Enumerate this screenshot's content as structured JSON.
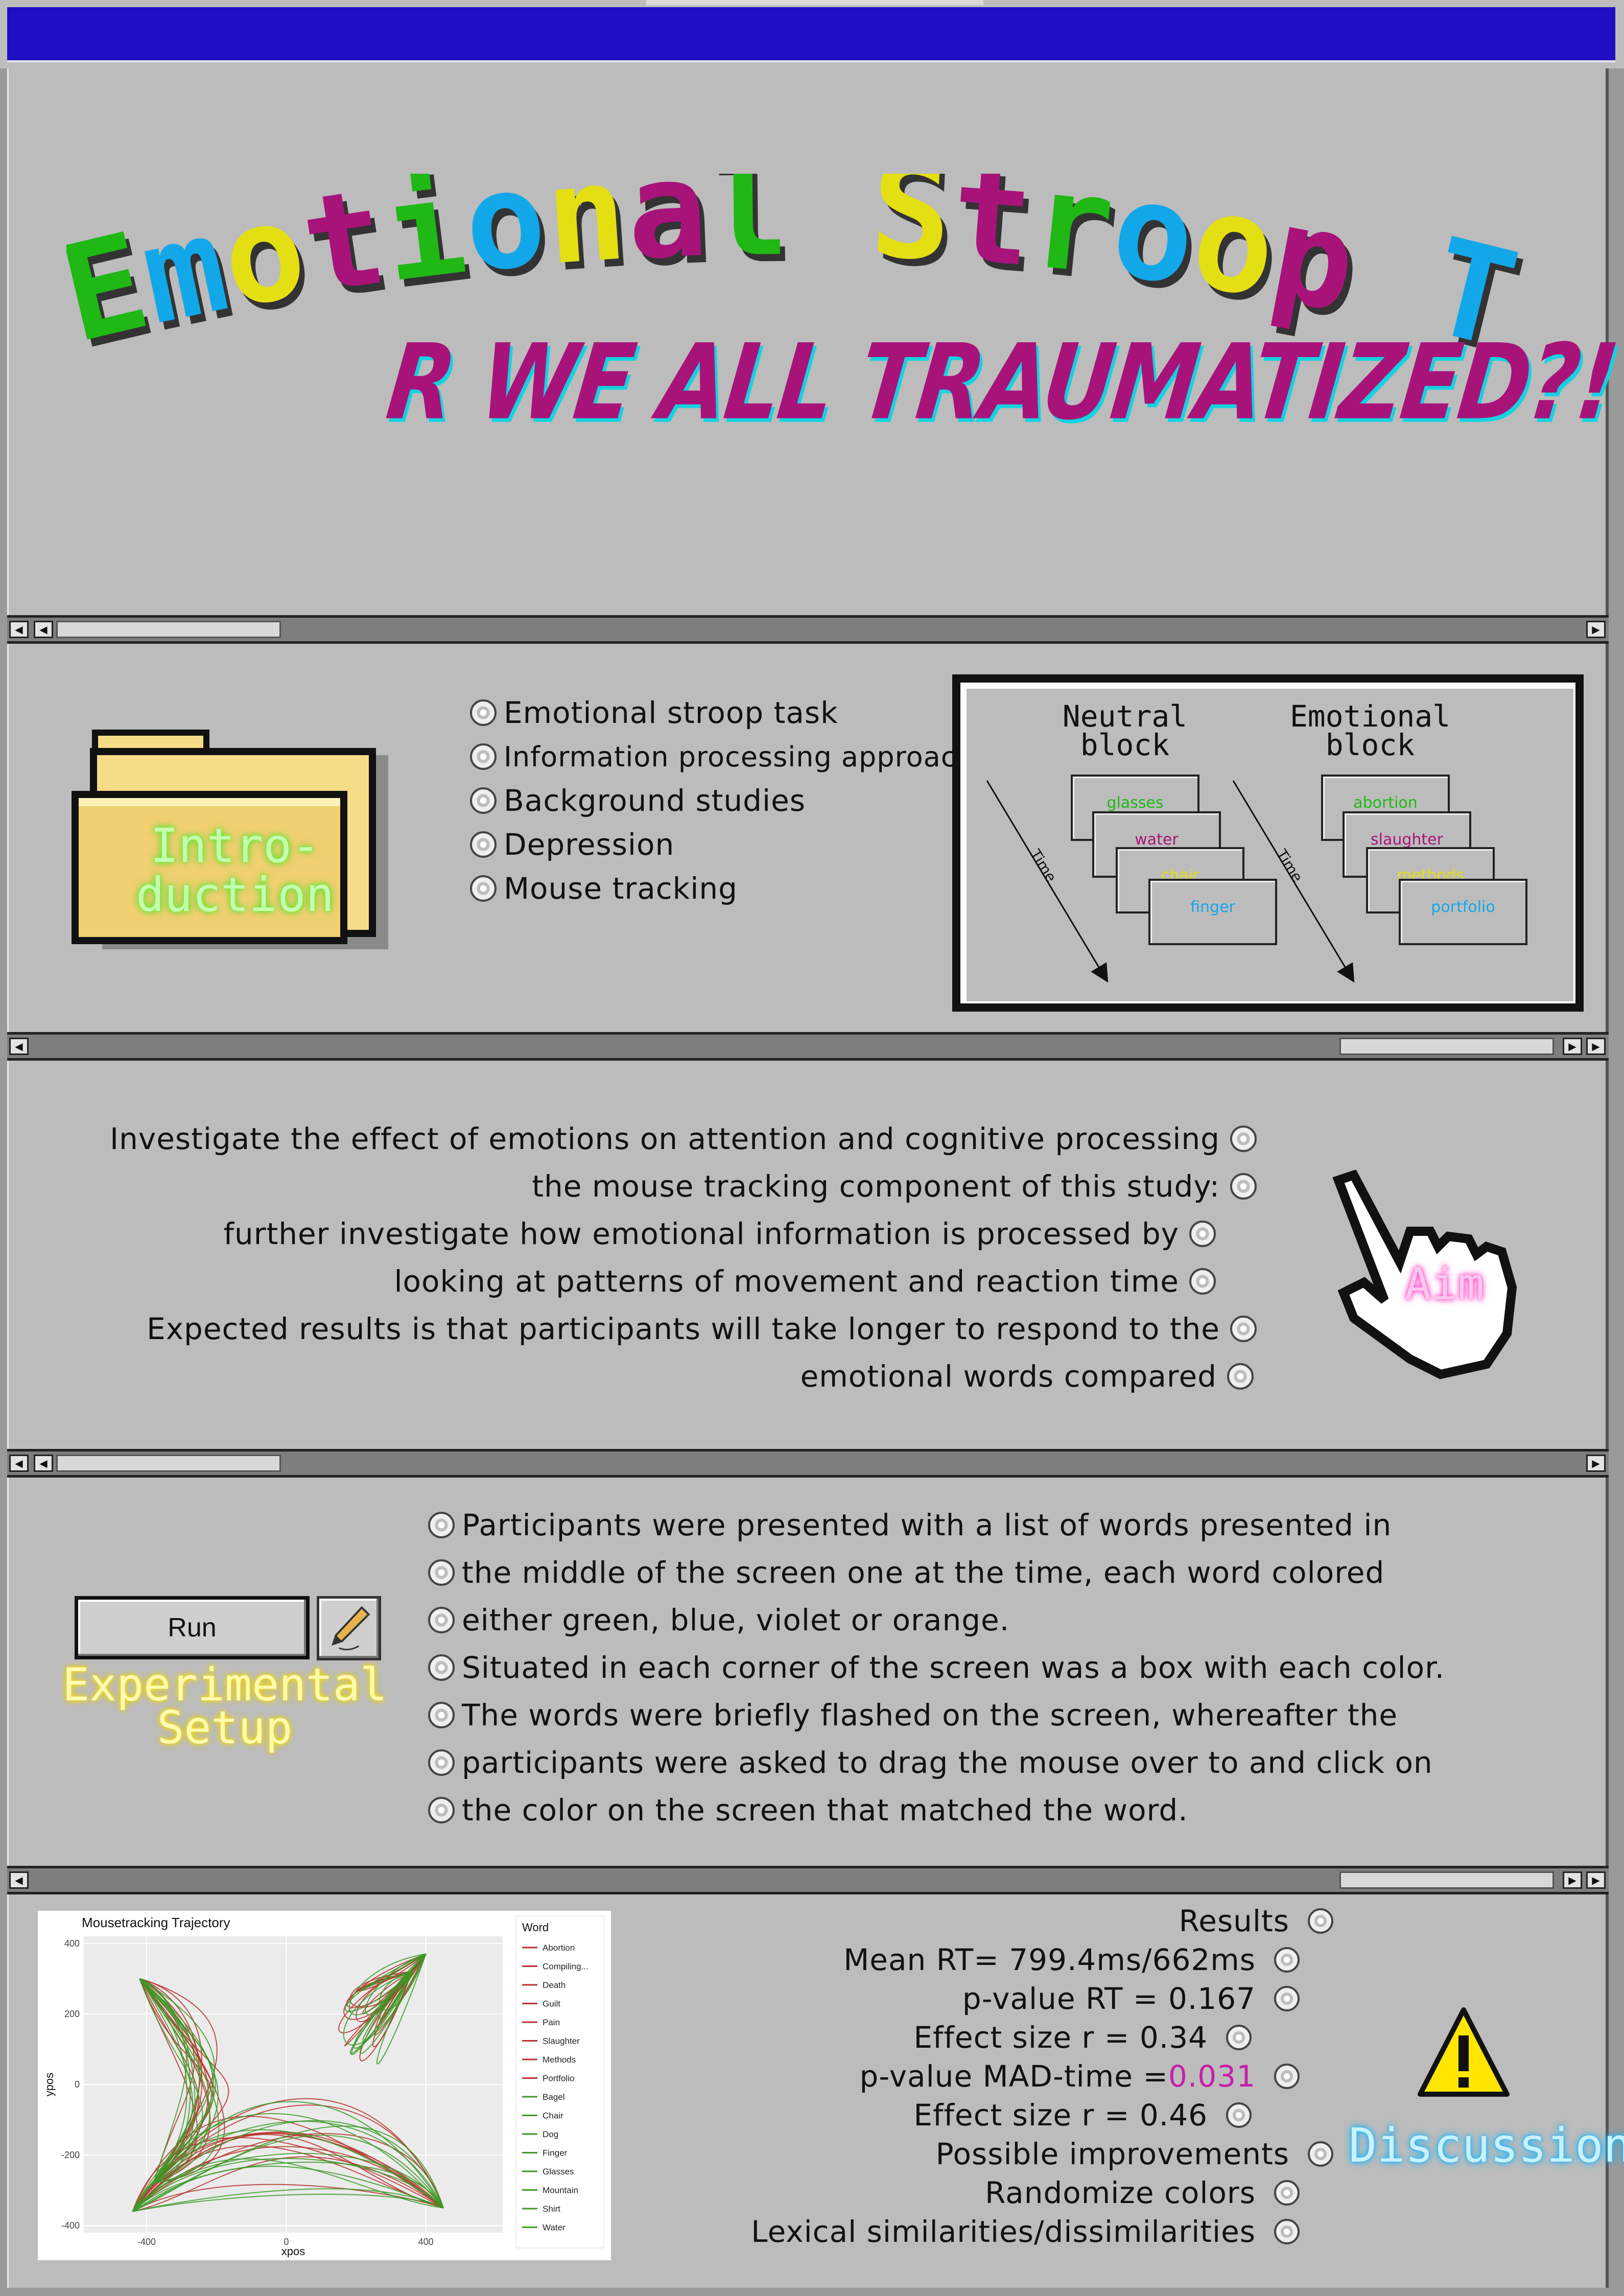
{
  "title": "Emotional Stroop Task",
  "subtitle": "R WE ALL TRAUMATIZED?!",
  "colors": {
    "titlebar": "#1f0fc4",
    "green": "#1fb814",
    "blue": "#12a7e8",
    "yellow": "#e4df12",
    "magenta": "#a8137a",
    "cyan": "#13d3e0"
  },
  "introduction": {
    "label": "Intro-duction",
    "items": [
      "Emotional stroop task",
      "Information processing approach",
      "Background studies",
      "Depression",
      "Mouse tracking"
    ]
  },
  "diagram": {
    "neutral_title": "Neutral block",
    "emotional_title": "Emotional block",
    "time_label": "Time",
    "neutral_words": [
      {
        "text": "glasses",
        "color": "#1fb814"
      },
      {
        "text": "water",
        "color": "#a8137a"
      },
      {
        "text": "chair",
        "color": "#e4df12"
      },
      {
        "text": "finger",
        "color": "#12a7e8"
      }
    ],
    "emotional_words": [
      {
        "text": "abortion",
        "color": "#1fb814"
      },
      {
        "text": "slaughter",
        "color": "#a8137a"
      },
      {
        "text": "methods",
        "color": "#e4df12"
      },
      {
        "text": "portfolio",
        "color": "#12a7e8"
      }
    ]
  },
  "aim": {
    "label": "Aim",
    "lines": [
      "Investigate the effect of emotions on attention and cognitive processing",
      "the mouse tracking component of this study:",
      "further investigate how emotional information is processed by",
      "looking at patterns of movement and reaction time",
      "Expected results is that participants will take longer to respond to the",
      "emotional words compared"
    ]
  },
  "experimental_setup": {
    "label": "Experimental Setup",
    "run_button": "Run",
    "lines": [
      "Participants were presented with a list of words presented in",
      "the middle of the screen one at the time, each word colored",
      "either green, blue, violet or orange.",
      "Situated in each corner of the screen was a box with each color.",
      "The words were briefly flashed on the screen, whereafter the",
      "participants were asked to drag the mouse over to and click on",
      "the color on the screen that matched the word."
    ]
  },
  "discussion": {
    "label": "Discussion",
    "results": [
      {
        "text": "Results",
        "highlight": ""
      },
      {
        "text": "Mean RT= 799.4ms/662ms",
        "highlight": ""
      },
      {
        "text": "p-value RT = 0.167",
        "highlight": ""
      },
      {
        "text": "Effect size r = 0.34",
        "highlight": ""
      },
      {
        "text": "p-value MAD-time =",
        "highlight": "0.031"
      },
      {
        "text": "Effect size r = 0.46",
        "highlight": ""
      },
      {
        "text": "Possible improvements",
        "highlight": ""
      },
      {
        "text": "Randomize colors",
        "highlight": ""
      },
      {
        "text": "Lexical similarities/dissimilarities",
        "highlight": ""
      }
    ]
  },
  "chart_data": {
    "type": "line",
    "title": "Mousetracking Trajectory",
    "xlabel": "xpos",
    "ylabel": "ypos",
    "xlim": [
      -580,
      620
    ],
    "ylim": [
      -420,
      420
    ],
    "xticks": [
      -400,
      0,
      400
    ],
    "yticks": [
      400,
      200,
      0,
      -200,
      -400
    ],
    "legend_title": "Word",
    "legend_position": "right",
    "series": [
      {
        "name": "Abortion",
        "color": "#b7312c"
      },
      {
        "name": "Compiling...",
        "color": "#b7312c"
      },
      {
        "name": "Death",
        "color": "#b7312c"
      },
      {
        "name": "Guilt",
        "color": "#b7312c"
      },
      {
        "name": "Pain",
        "color": "#b7312c"
      },
      {
        "name": "Slaughter",
        "color": "#b7312c"
      },
      {
        "name": "Methods",
        "color": "#b7312c"
      },
      {
        "name": "Portfolio",
        "color": "#b7312c"
      },
      {
        "name": "Bagel",
        "color": "#3a9a25"
      },
      {
        "name": "Chair",
        "color": "#3a9a25"
      },
      {
        "name": "Dog",
        "color": "#3a9a25"
      },
      {
        "name": "Finger",
        "color": "#3a9a25"
      },
      {
        "name": "Glasses",
        "color": "#3a9a25"
      },
      {
        "name": "Mountain",
        "color": "#3a9a25"
      },
      {
        "name": "Shirt",
        "color": "#3a9a25"
      },
      {
        "name": "Water",
        "color": "#3a9a25"
      }
    ]
  }
}
